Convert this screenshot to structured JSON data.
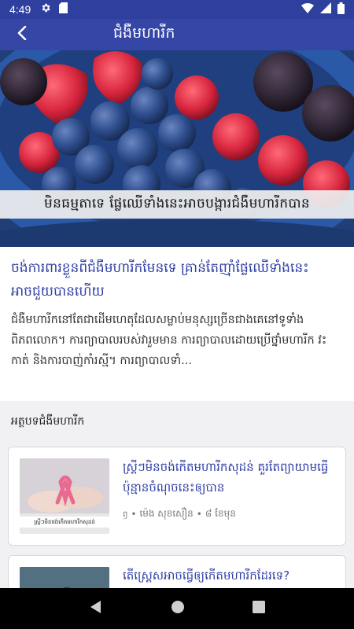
{
  "status_bar": {
    "time": "4:49",
    "icons": [
      "settings-gear",
      "sd-card",
      "wifi",
      "signal",
      "battery"
    ]
  },
  "app_bar": {
    "title": "ជំងឺមហារីក",
    "back_icon": "arrow-back"
  },
  "hero": {
    "caption": "មិនធម្មតាទេ  ផ្លែឈើទាំងនេះអាចបង្ការជំងឺមហារីកបាន"
  },
  "article": {
    "headline": "ចង់ការពារខ្លួនពីជំងឺមហារីកមែនទេ គ្រាន់តែញ៉ាំផ្លែឈើទាំងនេះអាចជួយបានហើយ",
    "summary": "ជំងឺមហារីកនៅតែជាដើមហេតុដែលសម្លាប់មនុស្សច្រើនជាងគេនៅទូទាំងពិភពលោក។ ការព្យាបាលរបស់វារួមមាន ការព្យាបាលដោយប្រើថ្នាំមហារីក វះកាត់ និងការបាញ់កាំរស្មី។ ការព្យាបាលទាំ..."
  },
  "related": {
    "section_title": "អត្ថបទជំងឺមហារីក",
    "items": [
      {
        "title": "ស្រ្តីៗមិនចង់កើតមហារីកសុដន់ គួរតែព្យាយាមធ្វើប៉ុន្មានចំណុចនេះឲ្យបាន",
        "author": "ម៉េង សុខសឿន",
        "time": "៨ ខែមុន",
        "thumb_caption": "ស្រ្តីៗមិនចង់កើតមហារីកសុដន់"
      },
      {
        "title": "តើស្ត្រេសអាចធ្វើឲ្យកើតមហារីកដែរទេ?",
        "author": "",
        "time": ""
      }
    ]
  },
  "nav_bar": {
    "icons": [
      "back-triangle",
      "home-circle",
      "recents-square"
    ]
  },
  "colors": {
    "app_bar": "#3646a6",
    "status_bar": "#2f3f9e",
    "accent_text": "#2f3ea3"
  }
}
